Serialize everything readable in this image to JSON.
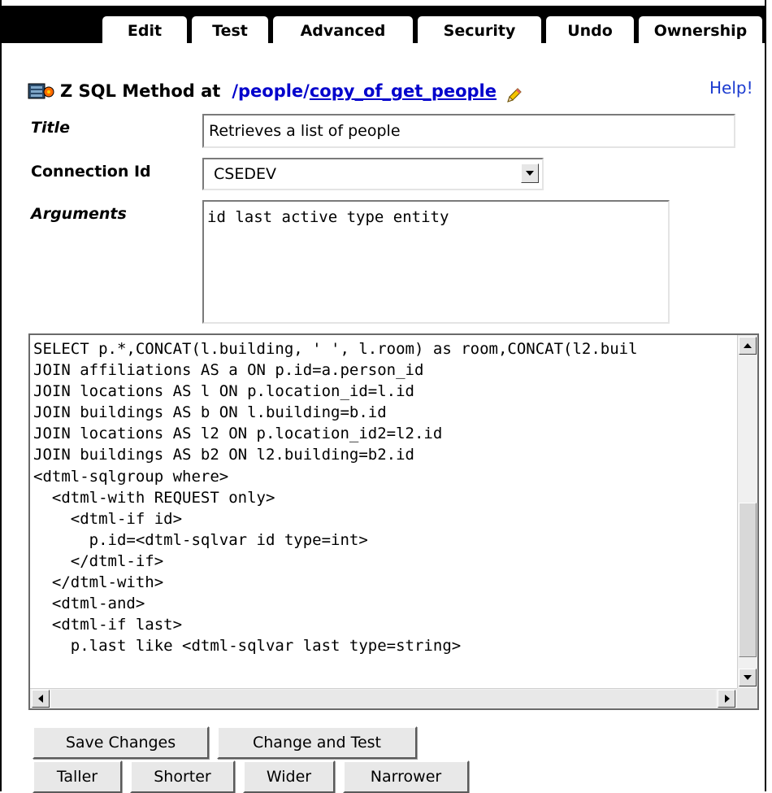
{
  "tabs": [
    {
      "label": "Edit",
      "active": true
    },
    {
      "label": "Test"
    },
    {
      "label": "Advanced"
    },
    {
      "label": "Security"
    },
    {
      "label": "Undo"
    },
    {
      "label": "Ownership"
    }
  ],
  "header": {
    "prefix": "Z SQL Method at",
    "path_root": "/people/",
    "path_object": "copy_of_get_people",
    "help_label": "Help!"
  },
  "form": {
    "title_label": "Title",
    "title_value": "Retrieves a list of people",
    "connection_label": "Connection Id",
    "connection_value": "CSEDEV",
    "arguments_label": "Arguments",
    "arguments_value": "id last active type entity"
  },
  "sql": {
    "lines": [
      "SELECT p.*,CONCAT(l.building, ' ', l.room) as room,CONCAT(l2.buil",
      "JOIN affiliations AS a ON p.id=a.person_id",
      "JOIN locations AS l ON p.location_id=l.id",
      "JOIN buildings AS b ON l.building=b.id",
      "JOIN locations AS l2 ON p.location_id2=l2.id",
      "JOIN buildings AS b2 ON l2.building=b2.id",
      "<dtml-sqlgroup where>",
      "  <dtml-with REQUEST only>",
      "    <dtml-if id>",
      "      p.id=<dtml-sqlvar id type=int>",
      "    </dtml-if>",
      "  </dtml-with>",
      "  <dtml-and>",
      "  <dtml-if last>",
      "    p.last like <dtml-sqlvar last type=string>"
    ]
  },
  "buttons": {
    "save": "Save Changes",
    "change_test": "Change and Test",
    "taller": "Taller",
    "shorter": "Shorter",
    "wider": "Wider",
    "narrower": "Narrower"
  }
}
